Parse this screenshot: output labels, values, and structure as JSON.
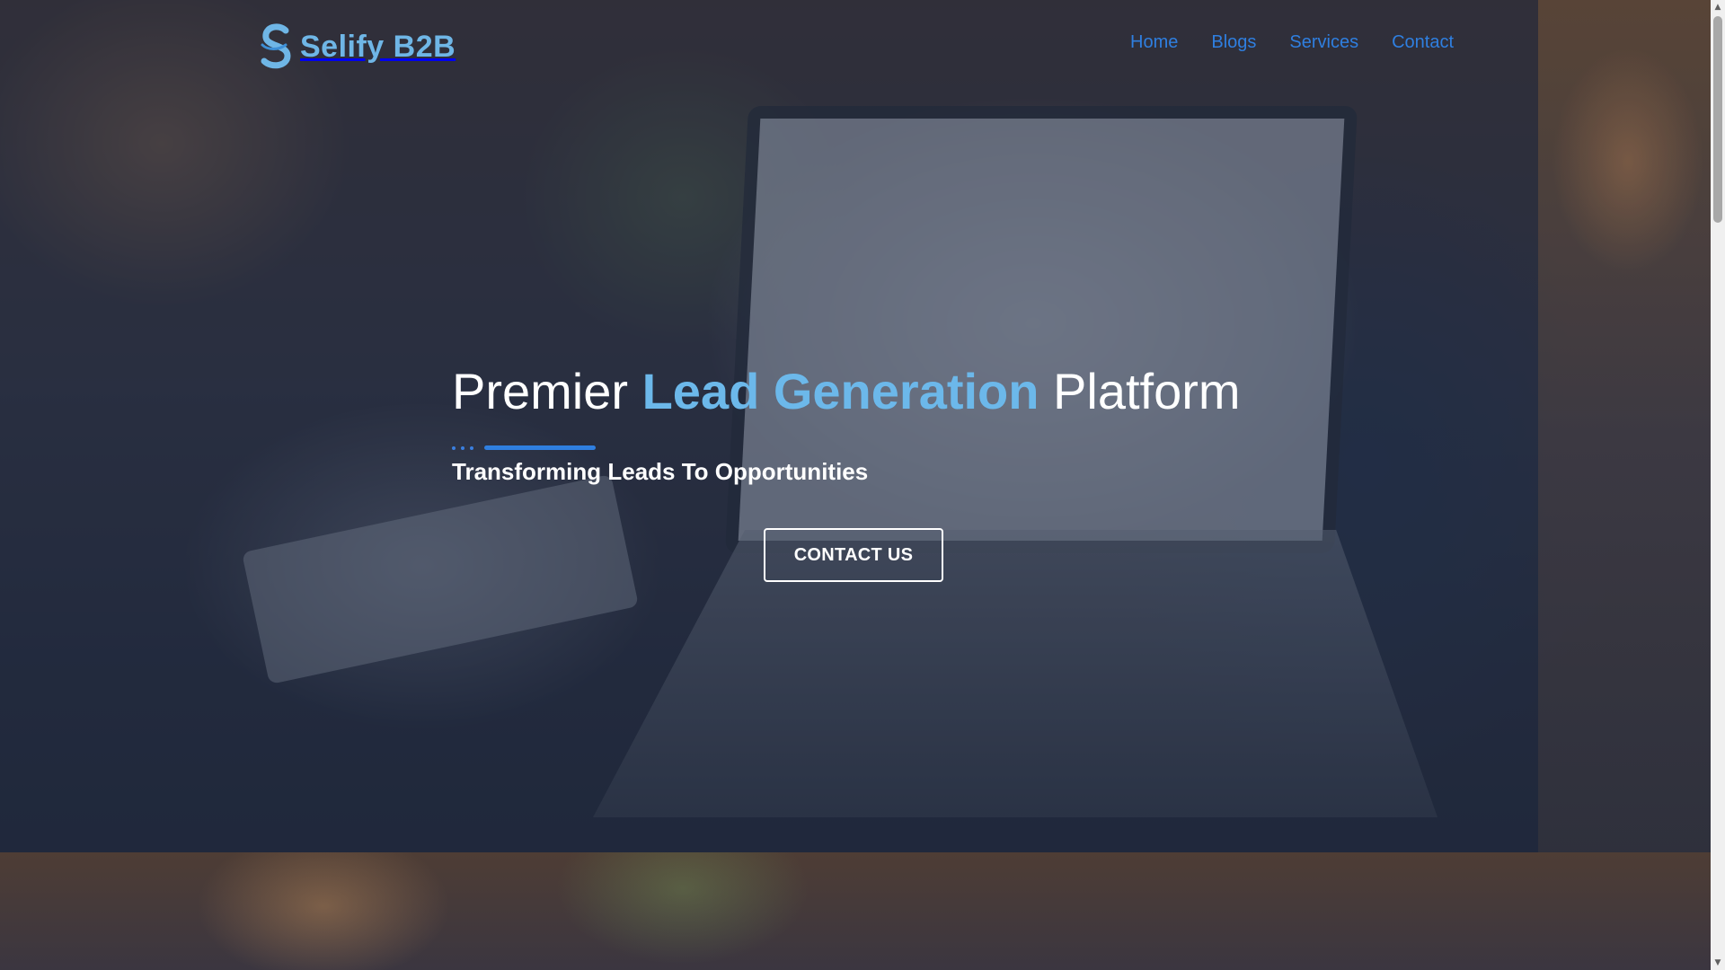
{
  "brand": {
    "name": "Selify B2B"
  },
  "nav": {
    "items": [
      {
        "label": "Home"
      },
      {
        "label": "Blogs"
      },
      {
        "label": "Services"
      },
      {
        "label": "Contact"
      }
    ]
  },
  "hero": {
    "title_part1": "Premier ",
    "title_accent": "Lead Generation",
    "title_part2": " Platform",
    "subtitle": "Transforming Leads To Opportunities",
    "cta_label": "CONTACT US"
  },
  "colors": {
    "accent": "#6cb8ea",
    "nav_link": "#2f7fe0",
    "divider": "#2f7fe0"
  },
  "icons": {
    "scroll_up": "up-arrow-icon",
    "scroll_down": "down-arrow-icon"
  }
}
